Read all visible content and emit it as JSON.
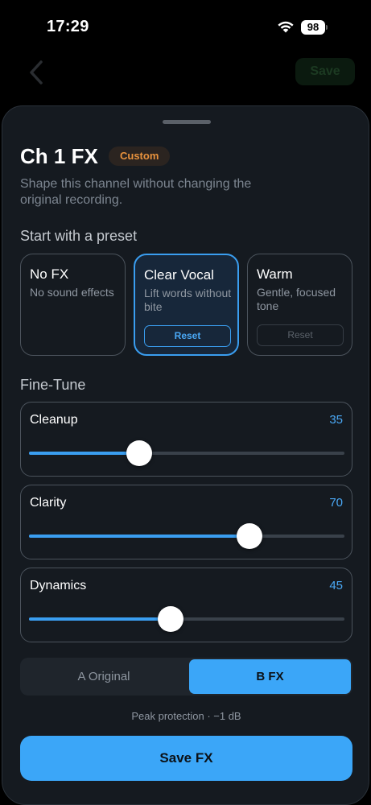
{
  "status_bar": {
    "time": "17:29",
    "battery": "98"
  },
  "background": {
    "back_icon": "chevron-left-icon",
    "save_label": "Save"
  },
  "sheet": {
    "title": "Ch 1 FX",
    "badge": "Custom",
    "subtitle": "Shape this channel without changing the original recording.",
    "preset_heading": "Start with a preset",
    "presets": [
      {
        "name": "No FX",
        "desc": "No sound effects",
        "selected": false
      },
      {
        "name": "Clear Vocal",
        "desc": "Lift words without bite",
        "selected": true,
        "reset": "Reset",
        "reset_enabled": true
      },
      {
        "name": "Warm",
        "desc": "Gentle, focused tone",
        "selected": false,
        "reset": "Reset",
        "reset_enabled": false
      }
    ],
    "finetune_heading": "Fine-Tune",
    "sliders": [
      {
        "label": "Cleanup",
        "value": "35",
        "level": 35
      },
      {
        "label": "Clarity",
        "value": "70",
        "level": 70
      },
      {
        "label": "Dynamics",
        "value": "45",
        "level": 45
      }
    ],
    "ab": {
      "a_label": "A  Original",
      "b_label": "B  FX",
      "selected": "B"
    },
    "peak_text": "Peak protection  ·  −1 dB",
    "save_label": "Save FX"
  },
  "colors": {
    "accent": "#3ba6f8",
    "badge_text": "#e8923d",
    "sheet_bg": "#151a20"
  }
}
